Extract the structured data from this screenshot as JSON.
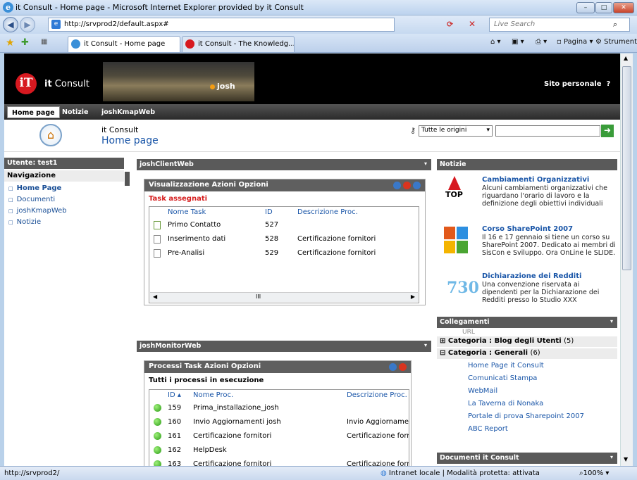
{
  "window": {
    "title": "it Consult - Home page - Microsoft Internet Explorer provided by it Consult",
    "controls": {
      "minimize": "–",
      "maximize": "□",
      "close": "✕"
    }
  },
  "browser": {
    "address": "http://srvprod2/default.aspx#",
    "search_placeholder": "Live Search",
    "tabs": [
      {
        "label": "it Consult - Home page"
      },
      {
        "label": "it Consult - The Knowledg..."
      }
    ],
    "commands": {
      "page": "Pagina",
      "tools": "Strumenti"
    }
  },
  "site": {
    "logo_text_bold": "it",
    "logo_text": " Consult",
    "user_name": "josh",
    "personal_site": "Sito personale",
    "help": "?",
    "nav_tabs": [
      "Home page",
      "Notizie",
      "joshKmapWeb"
    ],
    "site_name": "it Consult",
    "page_title": "Home page",
    "search_scope": "Tutte le origini"
  },
  "leftnav": {
    "user_label": "Utente: test1",
    "heading": "Navigazione",
    "items": [
      "Home Page",
      "Documenti",
      "joshKmapWeb",
      "Notizie"
    ]
  },
  "client_web": {
    "title": "joshClientWeb",
    "menu": "Visualizzazione  Azioni  Opzioni",
    "section": "Task assegnati",
    "columns": [
      "Nome Task",
      "ID",
      "Descrizione Proc."
    ],
    "rows": [
      {
        "name": "Primo Contatto",
        "id": "527",
        "desc": ""
      },
      {
        "name": "Inserimento dati",
        "id": "528",
        "desc": "Certificazione fornitori"
      },
      {
        "name": "Pre-Analisi",
        "id": "529",
        "desc": "Certificazione fornitori"
      }
    ],
    "scroll_grip": "III"
  },
  "monitor_web": {
    "title": "joshMonitorWeb",
    "menu": "Processi  Task  Azioni  Opzioni",
    "section": "Tutti i processi in esecuzione",
    "columns": [
      "ID",
      "Nome Proc.",
      "Descrizione Proc."
    ],
    "rows": [
      {
        "id": "159",
        "name": "Prima_installazione_josh",
        "desc": ""
      },
      {
        "id": "160",
        "name": "Invio Aggiornamenti josh",
        "desc": "Invio Aggiornamen"
      },
      {
        "id": "161",
        "name": "Certificazione fornitori",
        "desc": "Certificazione forni"
      },
      {
        "id": "162",
        "name": "HelpDesk",
        "desc": ""
      },
      {
        "id": "163",
        "name": "Certificazione fornitori",
        "desc": "Certificazione forni"
      }
    ]
  },
  "news": {
    "title": "Notizie",
    "items": [
      {
        "title": "Cambiamenti Organizzativi",
        "body": "Alcuni cambiamenti organizzativi che riguardano l'orario di lavoro e la definizione degli obiettivi individuali",
        "icon_label": "TOP"
      },
      {
        "title": "Corso SharePoint 2007",
        "body": "Il 16 e 17 gennaio si tiene un corso su SharePoint 2007. Dedicato ai membri di SisCon e Sviluppo. Ora OnLine le SLIDE."
      },
      {
        "title": "Dichiarazione dei Redditi",
        "body": "Una convenzione riservata ai dipendenti per la Dichiarazione dei Redditi presso lo Studio XXX",
        "icon_label": "730"
      }
    ]
  },
  "links": {
    "title": "Collegamenti",
    "url_header": "URL",
    "group1": {
      "label": "Categoria : Blog degli Utenti",
      "count": "(5)"
    },
    "group2": {
      "label": "Categoria : Generali",
      "count": "(6)"
    },
    "items": [
      "Home Page it Consult",
      "Comunicati Stampa",
      "WebMail",
      "La Taverna di Nonaka",
      "Portale di prova Sharepoint 2007",
      "ABC Report"
    ]
  },
  "documents": {
    "title": "Documenti it Consult"
  },
  "statusbar": {
    "url": "http://srvprod2/",
    "zone": "Intranet locale | Modalità protetta: attivata",
    "zoom": "100%"
  }
}
